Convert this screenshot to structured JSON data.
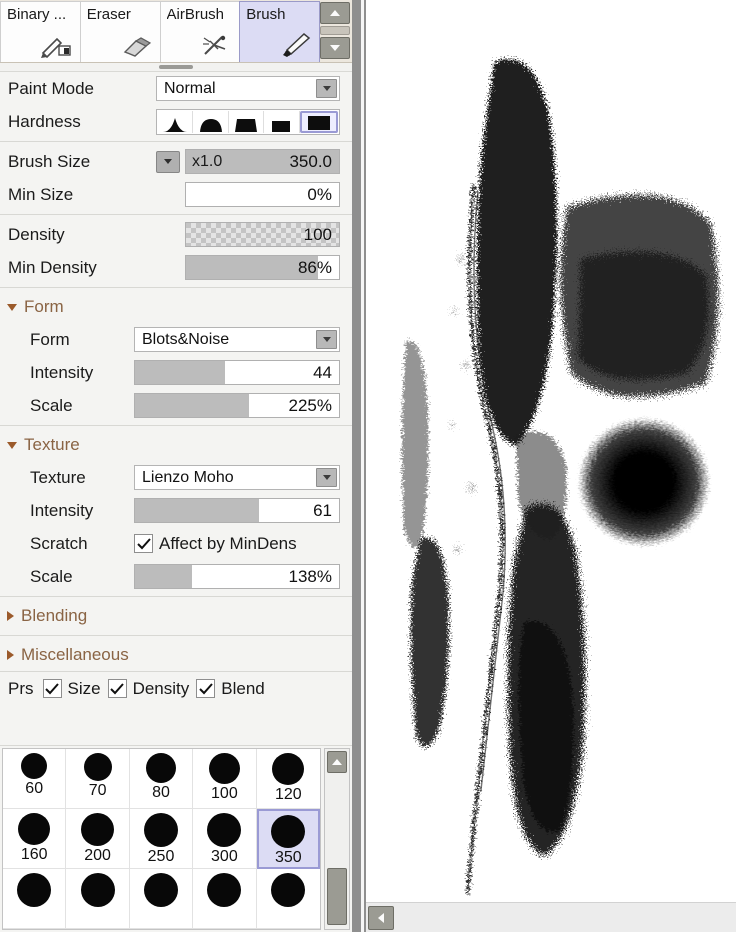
{
  "tool_tabs": {
    "items": [
      {
        "label": "Binary ...",
        "icon": "binary-pen-icon",
        "selected": false
      },
      {
        "label": "Eraser",
        "icon": "eraser-icon",
        "selected": false
      },
      {
        "label": "AirBrush",
        "icon": "airbrush-icon",
        "selected": false
      },
      {
        "label": "Brush",
        "icon": "brush-icon",
        "selected": true
      }
    ],
    "scroll_up": "scroll-up-icon",
    "scroll_down": "scroll-down-icon"
  },
  "settings": {
    "paint_mode": {
      "label": "Paint Mode",
      "value": "Normal"
    },
    "hardness": {
      "label": "Hardness",
      "options": [
        "sharp-peak",
        "rounded-bell",
        "flat-top",
        "rectangle",
        "solid-block"
      ],
      "selected_index": 4
    },
    "brush_size": {
      "label": "Brush Size",
      "multiplier": "x1.0",
      "value": "350.0",
      "fill_percent": 100
    },
    "min_size": {
      "label": "Min Size",
      "value": "0%",
      "fill_percent": 0
    },
    "density": {
      "label": "Density",
      "value": "100",
      "fill_percent": 100,
      "checkered": true
    },
    "min_density": {
      "label": "Min Density",
      "value": "86%",
      "fill_percent": 86
    }
  },
  "form_section": {
    "title": "Form",
    "expanded": true,
    "form": {
      "label": "Form",
      "value": "Blots&Noise"
    },
    "intensity": {
      "label": "Intensity",
      "value": "44",
      "fill_percent": 44
    },
    "scale": {
      "label": "Scale",
      "value": "225%",
      "fill_percent": 56
    }
  },
  "texture_section": {
    "title": "Texture",
    "expanded": true,
    "texture": {
      "label": "Texture",
      "value": "Lienzo Moho"
    },
    "intensity": {
      "label": "Intensity",
      "value": "61",
      "fill_percent": 61
    },
    "scratch": {
      "label": "Scratch",
      "checkbox_label": "Affect by MinDens",
      "checked": true
    },
    "scale": {
      "label": "Scale",
      "value": "138%",
      "fill_percent": 28
    }
  },
  "blending_section": {
    "title": "Blending",
    "expanded": false
  },
  "miscellaneous_section": {
    "title": "Miscellaneous",
    "expanded": false
  },
  "pressure_row": {
    "label": "Prs",
    "toggles": [
      {
        "label": "Size",
        "checked": true
      },
      {
        "label": "Density",
        "checked": true
      },
      {
        "label": "Blend",
        "checked": true
      }
    ]
  },
  "brush_presets": {
    "items": [
      {
        "name": "60",
        "dot": 26,
        "selected": false
      },
      {
        "name": "70",
        "dot": 28,
        "selected": false
      },
      {
        "name": "80",
        "dot": 30,
        "selected": false
      },
      {
        "name": "100",
        "dot": 31,
        "selected": false
      },
      {
        "name": "120",
        "dot": 32,
        "selected": false
      },
      {
        "name": "160",
        "dot": 32,
        "selected": false
      },
      {
        "name": "200",
        "dot": 33,
        "selected": false
      },
      {
        "name": "250",
        "dot": 34,
        "selected": false
      },
      {
        "name": "300",
        "dot": 34,
        "selected": false
      },
      {
        "name": "350",
        "dot": 34,
        "selected": true
      },
      {
        "name": "",
        "dot": 34,
        "selected": false
      },
      {
        "name": "",
        "dot": 34,
        "selected": false
      },
      {
        "name": "",
        "dot": 34,
        "selected": false
      },
      {
        "name": "",
        "dot": 34,
        "selected": false
      },
      {
        "name": "",
        "dot": 34,
        "selected": false
      }
    ],
    "scroll_up": "scroll-up-icon"
  },
  "canvas": {
    "scroll_left": "scroll-left-icon"
  },
  "colors": {
    "panel_bg": "#f4f4f2",
    "tab_strip_bg": "#ece7de",
    "selection": "#dcdcf4",
    "selection_border": "#9a9ad4",
    "section_header_text": "#8a6444",
    "slider_fill": "#bcbcbc",
    "ink": "#080808",
    "canvas_bg": "#ffffff"
  }
}
